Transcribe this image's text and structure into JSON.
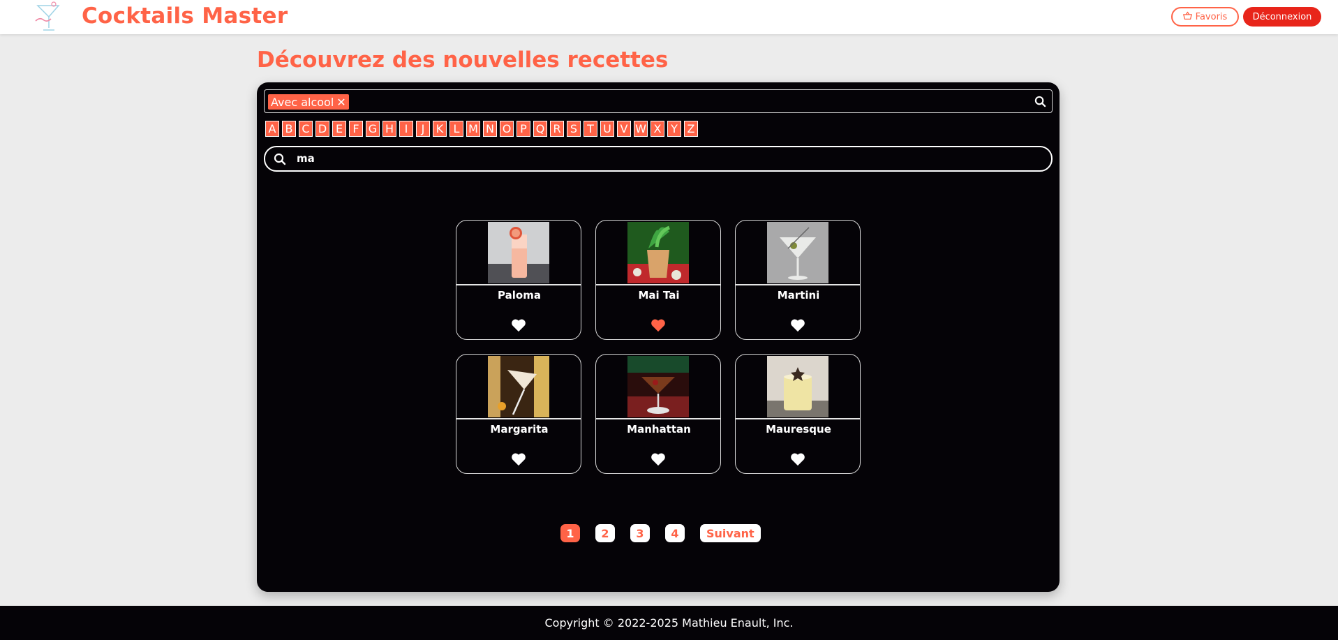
{
  "header": {
    "brand": "Cocktails Master",
    "favorites_label": "Favoris",
    "logout_label": "Déconnexion"
  },
  "page_title": "Découvrez des nouvelles recettes",
  "filter": {
    "chip_label": "Avec alcool",
    "chip_remove": "✕"
  },
  "letters": [
    "A",
    "B",
    "C",
    "D",
    "E",
    "F",
    "G",
    "H",
    "I",
    "J",
    "K",
    "L",
    "M",
    "N",
    "O",
    "P",
    "Q",
    "R",
    "S",
    "T",
    "U",
    "V",
    "W",
    "X",
    "Y",
    "Z"
  ],
  "search": {
    "value": "ma"
  },
  "cocktails": [
    {
      "name": "Paloma",
      "favorite": false
    },
    {
      "name": "Mai Tai",
      "favorite": true
    },
    {
      "name": "Martini",
      "favorite": false
    },
    {
      "name": "Margarita",
      "favorite": false
    },
    {
      "name": "Manhattan",
      "favorite": false
    },
    {
      "name": "Mauresque",
      "favorite": false
    }
  ],
  "pagination": {
    "pages": [
      "1",
      "2",
      "3",
      "4"
    ],
    "current": "1",
    "next_label": "Suivant"
  },
  "footer": {
    "copyright": "Copyright © 2022-2025 Mathieu Enault, Inc."
  },
  "colors": {
    "accent": "#ff6347",
    "logout": "#e8251a",
    "panel": "#050307",
    "favorite": "#ff6347",
    "heart_default": "#ffffff"
  }
}
